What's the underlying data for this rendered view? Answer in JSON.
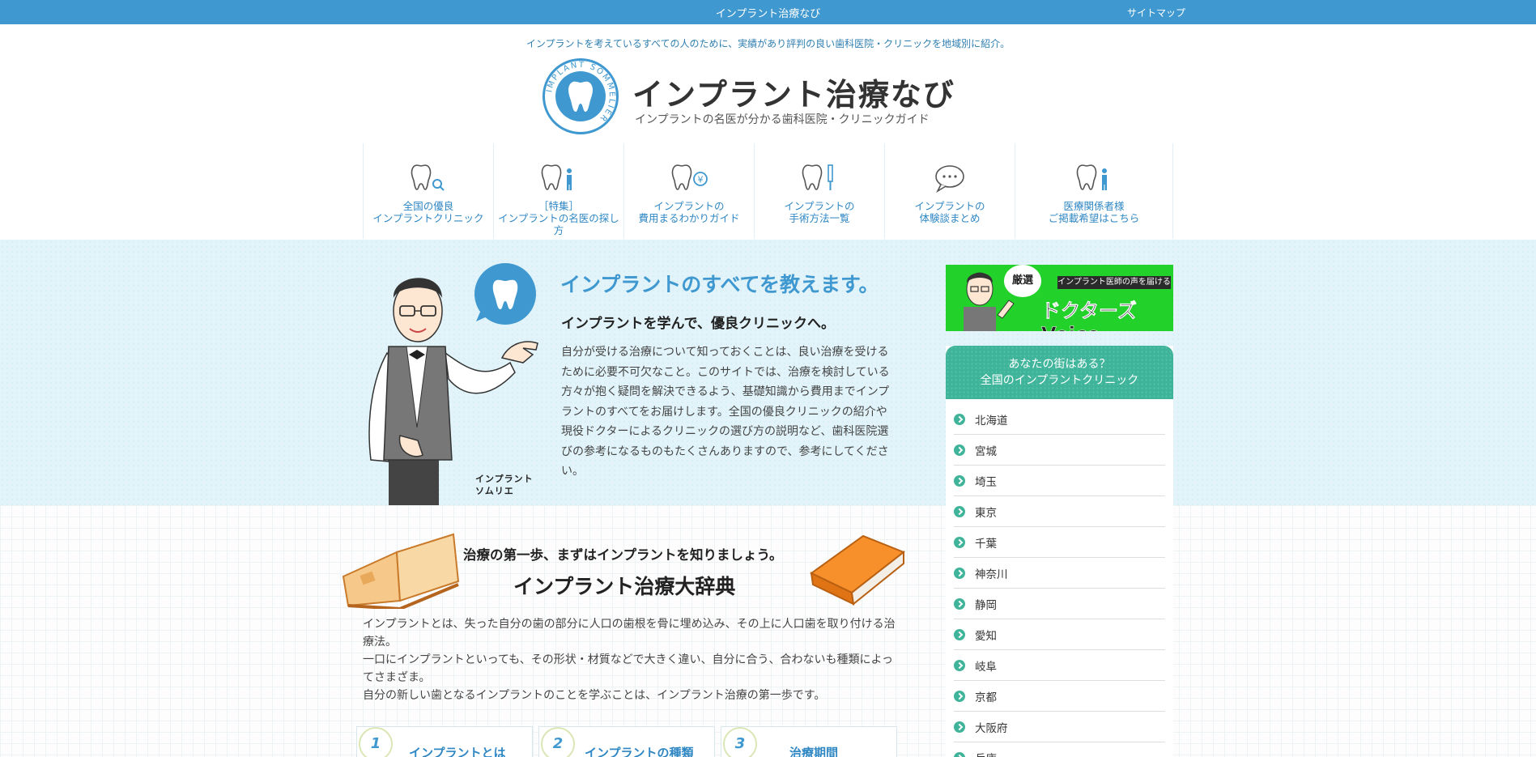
{
  "topbar": {
    "title": "インプラント治療なび",
    "sitemap": "サイトマップ"
  },
  "tagline": "インプラントを考えているすべての人のために、実績があり評判の良い歯科医院・クリニックを地域別に紹介。",
  "logo": {
    "title": "インプラント治療なび",
    "subtitle": "インプラントの名医が分かる歯科医院・クリニックガイド",
    "ring_text": "IMPLANT SOMMELIER"
  },
  "nav": [
    {
      "line1": "全国の優良",
      "line2": "インプラントクリニック",
      "icon": "tooth-search-icon"
    },
    {
      "line1": "［特集］",
      "line2": "インプラントの名医の探し方",
      "icon": "tooth-doctor-icon"
    },
    {
      "line1": "インプラントの",
      "line2": "費用まるわかりガイド",
      "icon": "tooth-yen-icon"
    },
    {
      "line1": "インプラントの",
      "line2": "手術方法一覧",
      "icon": "tooth-tool-icon"
    },
    {
      "line1": "インプラントの",
      "line2": "体験談まとめ",
      "icon": "speech-bubble-icon"
    },
    {
      "line1": "医療関係者様",
      "line2": "ご掲載希望はこちら",
      "icon": "tooth-person-icon"
    }
  ],
  "hero": {
    "title": "インプラントのすべてを教えます。",
    "subtitle": "インプラントを学んで、優良クリニックへ。",
    "body": "自分が受ける治療について知っておくことは、良い治療を受けるために必要不可欠なこと。このサイトでは、治療を検討している方々が抱く疑問を解決できるよう、基礎知識から費用までインプラントのすべてをお届けします。全国の優良クリニックの紹介や現役ドクターによるクリニックの選び方の説明など、歯科医院選びの参考になるものもたくさんありますので、参考にしてください。",
    "caption_line1": "インプラント",
    "caption_line2": "ソムリエ"
  },
  "dictionary": {
    "lead": "治療の第一歩、まずはインプラントを知りましょう。",
    "title": "インプラント治療大辞典",
    "body_lines": [
      "インプラントとは、失った自分の歯の部分に人口の歯根を骨に埋め込み、その上に人口歯を取り付ける治療法。",
      "一口にインプラントといっても、その形状・材質などで大きく違い、自分に合う、合わないも種類によってさまざま。",
      "自分の新しい歯となるインプラントのことを学ぶことは、インプラント治療の第一歩です。"
    ],
    "cards": [
      {
        "num": "1",
        "title": "インプラントとは"
      },
      {
        "num": "2",
        "title": "インプラントの種類"
      },
      {
        "num": "3",
        "title": "治療期間"
      }
    ]
  },
  "banner": {
    "badge": "厳選",
    "tag": "インプラント医師の声を届ける",
    "title": "ドクターズVoice"
  },
  "sidebar": {
    "head_line1": "あなたの街はある？",
    "head_line2": "全国のインプラントクリニック",
    "regions": [
      "北海道",
      "宮城",
      "埼玉",
      "東京",
      "千葉",
      "神奈川",
      "静岡",
      "愛知",
      "岐阜",
      "京都",
      "大阪府",
      "兵庫"
    ]
  },
  "colors": {
    "primary": "#3f98cf",
    "accent_green": "#3fb49a",
    "hero_bg": "#e2f4fa"
  }
}
